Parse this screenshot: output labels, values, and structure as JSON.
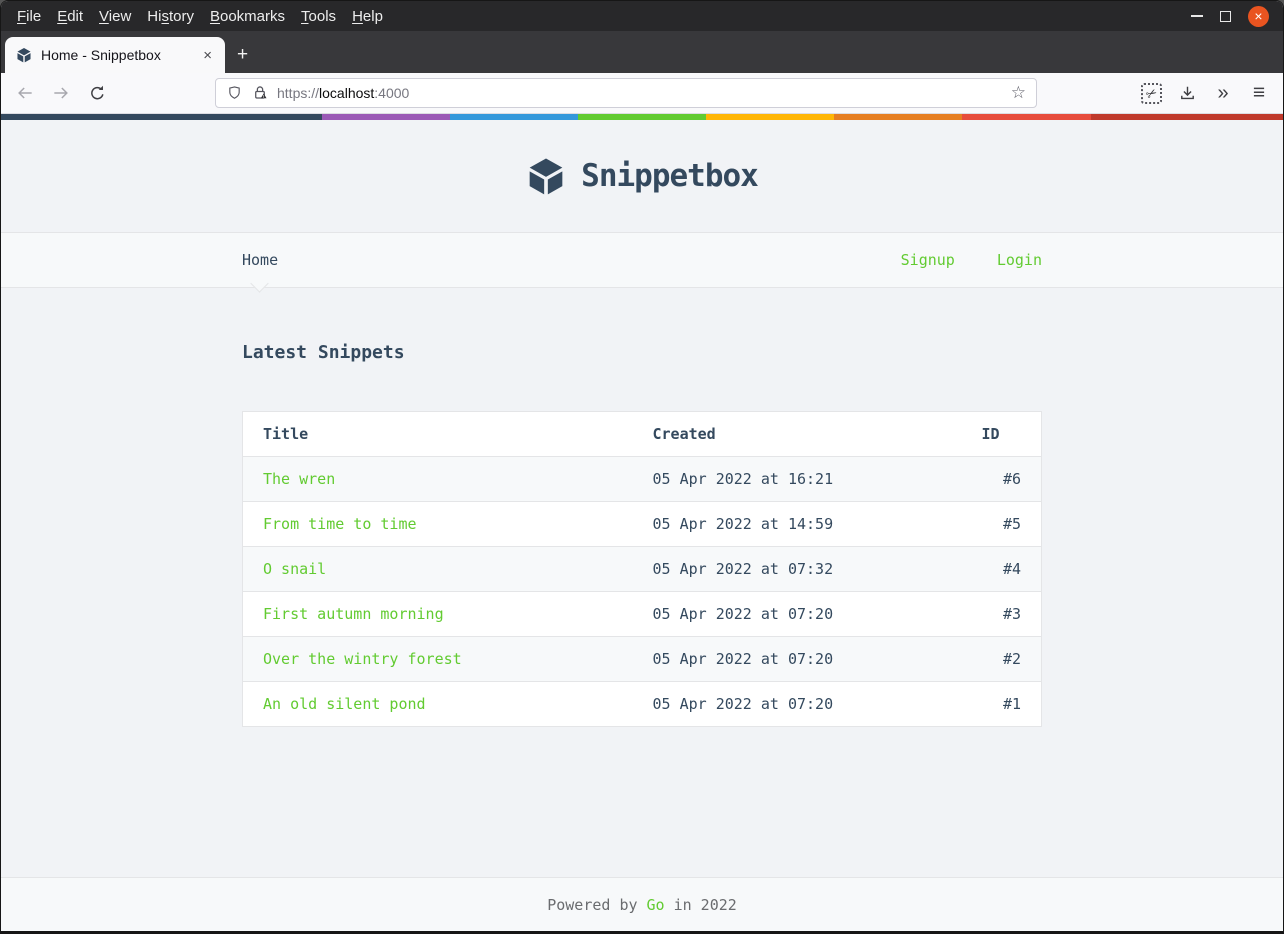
{
  "browser": {
    "menubar": {
      "items": [
        {
          "label": "File",
          "underline": 0
        },
        {
          "label": "Edit",
          "underline": 0
        },
        {
          "label": "View",
          "underline": 0
        },
        {
          "label": "History",
          "underline": 2
        },
        {
          "label": "Bookmarks",
          "underline": 0
        },
        {
          "label": "Tools",
          "underline": 0
        },
        {
          "label": "Help",
          "underline": 0
        }
      ]
    },
    "window_controls": {
      "minimize": "minimize",
      "maximize": "maximize",
      "close_glyph": "×"
    },
    "tab": {
      "title": "Home - Snippetbox",
      "close_glyph": "×"
    },
    "new_tab_glyph": "+",
    "urlbar": {
      "scheme": "https://",
      "host": "localhost",
      "port": ":4000"
    },
    "icons": {
      "back": "←",
      "forward": "→",
      "star": "☆",
      "scissors": "✂",
      "overflow": "»",
      "menu": "≡"
    }
  },
  "stripe": {
    "segments": [
      {
        "color": "#34495E",
        "width": 25
      },
      {
        "color": "#9B59B6",
        "width": 10
      },
      {
        "color": "#3498DB",
        "width": 10
      },
      {
        "color": "#62CB31",
        "width": 10
      },
      {
        "color": "#FFB606",
        "width": 10
      },
      {
        "color": "#E67E22",
        "width": 10
      },
      {
        "color": "#E74C3C",
        "width": 10
      },
      {
        "color": "#C0392B",
        "width": 15
      }
    ]
  },
  "page": {
    "logo_text": "Snippetbox",
    "nav": {
      "home": "Home",
      "signup": "Signup",
      "login": "Login"
    },
    "heading": "Latest Snippets",
    "table": {
      "columns": [
        "Title",
        "Created",
        "ID"
      ],
      "rows": [
        {
          "title": "The wren",
          "created": "05 Apr 2022 at 16:21",
          "id": "#6"
        },
        {
          "title": "From time to time",
          "created": "05 Apr 2022 at 14:59",
          "id": "#5"
        },
        {
          "title": "O snail",
          "created": "05 Apr 2022 at 07:32",
          "id": "#4"
        },
        {
          "title": "First autumn morning",
          "created": "05 Apr 2022 at 07:20",
          "id": "#3"
        },
        {
          "title": "Over the wintry forest",
          "created": "05 Apr 2022 at 07:20",
          "id": "#2"
        },
        {
          "title": "An old silent pond",
          "created": "05 Apr 2022 at 07:20",
          "id": "#1"
        }
      ]
    },
    "footer": {
      "prefix": "Powered by",
      "link": "Go",
      "suffix": "in 2022"
    }
  },
  "colors": {
    "body_bg": "#F1F3F6",
    "panel_bg": "#F7F9FA",
    "border": "#E4E5E7",
    "text": "#34495E",
    "accent_green": "#62CB31",
    "muted": "#6A6C6F",
    "close_button": "#E95420"
  }
}
